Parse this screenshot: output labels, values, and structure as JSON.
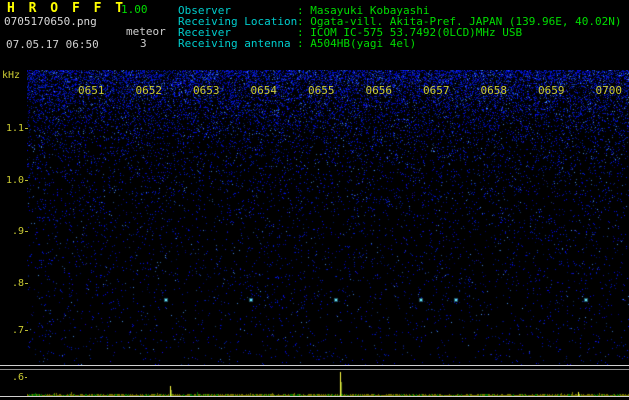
{
  "app": {
    "title": "H R O F F T",
    "version": "1.00",
    "filename": "0705170650.png",
    "mode_label": "meteor",
    "meteor_count": "3",
    "datetime": "07.05.17 06:50"
  },
  "station_info": {
    "rows": [
      {
        "label": "Observer",
        "value": ": Masayuki Kobayashi"
      },
      {
        "label": "Receiving Location",
        "value": ": Ogata-vill. Akita-Pref. JAPAN (139.96E, 40.02N)"
      },
      {
        "label": "Receiver",
        "value": ": ICOM IC-575 53.7492(0LCD)MHz USB"
      },
      {
        "label": "Receiving antenna",
        "value": ": A504HB(yagi 4el)"
      }
    ]
  },
  "spectrogram": {
    "time_labels": [
      "0651",
      "0652",
      "0653",
      "0654",
      "0655",
      "0656",
      "0657",
      "0658",
      "0659",
      "0700"
    ],
    "freq_axis_labels": [
      "kHz",
      "1.1",
      "1.0",
      ".9",
      ".8",
      ".7",
      ".6"
    ],
    "echo_marks": {
      "x_fractions": [
        0.229,
        0.37,
        0.512,
        0.653,
        0.711,
        0.927
      ],
      "y_fraction": 0.777
    },
    "colors": {
      "background": "#000000",
      "noise": "#2222ff",
      "echo": "#66eeff",
      "axis_text": "#cccc33"
    }
  },
  "level_strip": {
    "spikes": [
      {
        "x_fraction": 0.237,
        "height_fraction": 0.4
      },
      {
        "x_fraction": 0.52,
        "height_fraction": 1.0
      },
      {
        "x_fraction": 0.915,
        "height_fraction": 0.16
      }
    ],
    "colors": {
      "baseline": "#7a7a00",
      "baseline_alt": "#007700",
      "spike": "#ffff44"
    }
  }
}
